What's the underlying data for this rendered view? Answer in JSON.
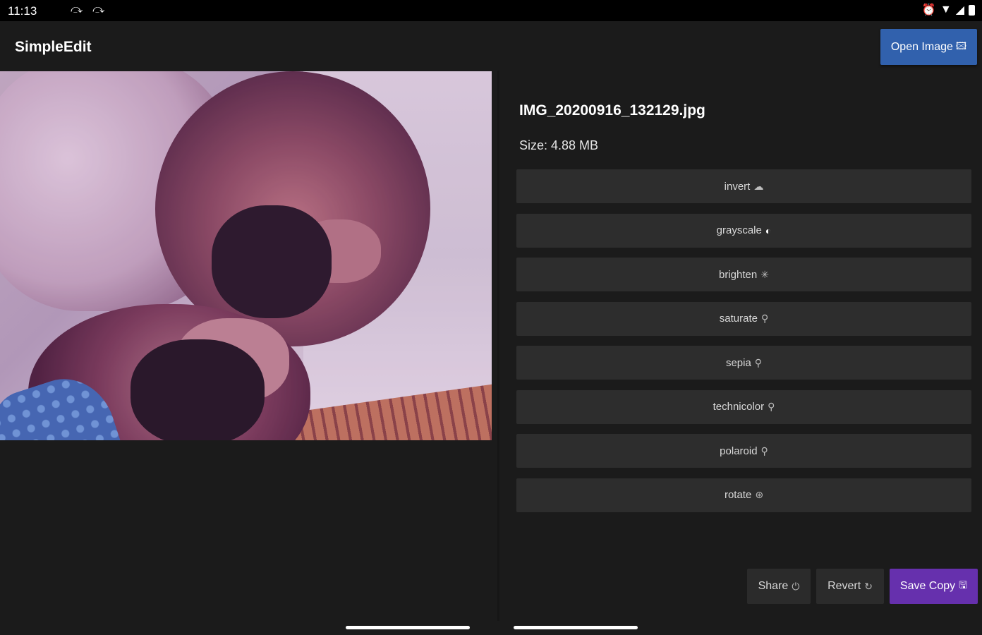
{
  "status_bar": {
    "time": "11:13",
    "left_icons": [
      "cast-icon",
      "cast-icon"
    ],
    "right_icons": [
      "alarm-icon",
      "wifi-icon",
      "signal-icon",
      "battery-icon"
    ]
  },
  "app": {
    "title": "SimpleEdit",
    "open_image_label": "Open Image"
  },
  "file": {
    "name": "IMG_20200916_132129.jpg",
    "size_label": "Size: 4.88 MB"
  },
  "filters": [
    {
      "label": "invert",
      "icon": "☁"
    },
    {
      "label": "grayscale",
      "icon": "◐"
    },
    {
      "label": "brighten",
      "icon": "✳"
    },
    {
      "label": "saturate",
      "icon": "⚲"
    },
    {
      "label": "sepia",
      "icon": "⚲"
    },
    {
      "label": "technicolor",
      "icon": "⚲"
    },
    {
      "label": "polaroid",
      "icon": "⚲"
    },
    {
      "label": "rotate",
      "icon": "⊛"
    }
  ],
  "actions": {
    "share_label": "Share",
    "revert_label": "Revert",
    "save_copy_label": "Save Copy"
  },
  "colors": {
    "background": "#1b1b1b",
    "open_button": "#3161ad",
    "save_button": "#6630ad",
    "filter_button": "#2d2d2d"
  }
}
